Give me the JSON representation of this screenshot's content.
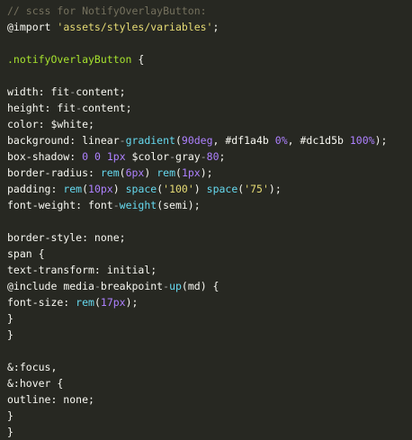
{
  "editor": {
    "lines": [
      [
        [
          "comment",
          "// scss for NotifyOverlayButton:"
        ]
      ],
      [
        [
          "keyword",
          "@import "
        ],
        [
          "string",
          "'assets/styles/variables'"
        ],
        [
          "punct",
          ";"
        ]
      ],
      [],
      [
        [
          "selector",
          ".notifyOverlayButton "
        ],
        [
          "punct",
          "{"
        ]
      ],
      [],
      [
        [
          "plain",
          "width: fit"
        ],
        [
          "dim",
          "-"
        ],
        [
          "plain",
          "content;"
        ]
      ],
      [
        [
          "plain",
          "height: fit"
        ],
        [
          "dim",
          "-"
        ],
        [
          "plain",
          "content;"
        ]
      ],
      [
        [
          "plain",
          "color: $white;"
        ]
      ],
      [
        [
          "plain",
          "background: linear"
        ],
        [
          "dim",
          "-"
        ],
        [
          "func",
          "gradient"
        ],
        [
          "plain",
          "("
        ],
        [
          "number",
          "90deg"
        ],
        [
          "plain",
          ", #df1a4b "
        ],
        [
          "number",
          "0%"
        ],
        [
          "plain",
          ", #dc1d5b "
        ],
        [
          "number",
          "100%"
        ],
        [
          "plain",
          ");"
        ]
      ],
      [
        [
          "plain",
          "box-shadow: "
        ],
        [
          "number",
          "0"
        ],
        [
          "plain",
          " "
        ],
        [
          "number",
          "0"
        ],
        [
          "plain",
          " "
        ],
        [
          "number",
          "1px"
        ],
        [
          "plain",
          " $color"
        ],
        [
          "dim",
          "-"
        ],
        [
          "plain",
          "gray"
        ],
        [
          "dim",
          "-"
        ],
        [
          "number",
          "80"
        ],
        [
          "plain",
          ";"
        ]
      ],
      [
        [
          "plain",
          "border-radius: "
        ],
        [
          "func",
          "rem"
        ],
        [
          "plain",
          "("
        ],
        [
          "number",
          "6px"
        ],
        [
          "plain",
          ") "
        ],
        [
          "func",
          "rem"
        ],
        [
          "plain",
          "("
        ],
        [
          "number",
          "1px"
        ],
        [
          "plain",
          ");"
        ]
      ],
      [
        [
          "plain",
          "padding: "
        ],
        [
          "func",
          "rem"
        ],
        [
          "plain",
          "("
        ],
        [
          "number",
          "10px"
        ],
        [
          "plain",
          ") "
        ],
        [
          "func",
          "space"
        ],
        [
          "plain",
          "("
        ],
        [
          "string",
          "'100'"
        ],
        [
          "plain",
          ") "
        ],
        [
          "func",
          "space"
        ],
        [
          "plain",
          "("
        ],
        [
          "string",
          "'75'"
        ],
        [
          "plain",
          ");"
        ]
      ],
      [
        [
          "plain",
          "font-weight: font"
        ],
        [
          "dim",
          "-"
        ],
        [
          "func",
          "weight"
        ],
        [
          "plain",
          "(semi);"
        ]
      ],
      [],
      [
        [
          "plain",
          "border-style: none;"
        ]
      ],
      [
        [
          "plain",
          "span "
        ],
        [
          "punct",
          "{"
        ]
      ],
      [
        [
          "plain",
          "text-transform: initial;"
        ]
      ],
      [
        [
          "keyword",
          "@include "
        ],
        [
          "plain",
          "media"
        ],
        [
          "dim",
          "-"
        ],
        [
          "plain",
          "breakpoint"
        ],
        [
          "dim",
          "-"
        ],
        [
          "func",
          "up"
        ],
        [
          "plain",
          "(md) "
        ],
        [
          "punct",
          "{"
        ]
      ],
      [
        [
          "plain",
          "font-size: "
        ],
        [
          "func",
          "rem"
        ],
        [
          "plain",
          "("
        ],
        [
          "number",
          "17px"
        ],
        [
          "plain",
          ");"
        ]
      ],
      [
        [
          "punct",
          "}"
        ]
      ],
      [
        [
          "punct",
          "}"
        ]
      ],
      [],
      [
        [
          "plain",
          "&:focus,"
        ]
      ],
      [
        [
          "plain",
          "&:hover "
        ],
        [
          "punct",
          "{"
        ]
      ],
      [
        [
          "plain",
          "outline: none;"
        ]
      ],
      [
        [
          "punct",
          "}"
        ]
      ],
      [
        [
          "punct",
          "}"
        ]
      ]
    ]
  }
}
